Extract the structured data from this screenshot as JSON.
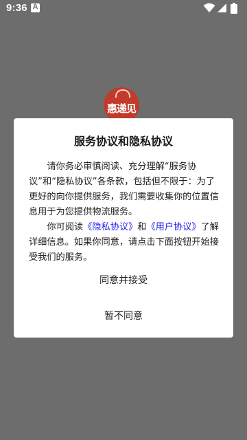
{
  "status_bar": {
    "time": "9:36",
    "notification_letter": "A",
    "icons": [
      "wifi-icon",
      "signal-icon",
      "battery-icon"
    ]
  },
  "app_logo": {
    "text": "惠递见"
  },
  "dialog": {
    "title": "服务协议和隐私协议",
    "paragraph1": "请你务必审慎阅读、充分理解“服务协议”和“隐私协议”各条款，包括但不限于：为了更好的向你提供服务，我们需要收集你的位置信息用于为您提供物流服务。",
    "paragraph2": {
      "prefix": "你可阅读",
      "privacy_link": "《隐私协议》",
      "middle": "和",
      "user_link": "《用户协议》",
      "suffix": "了解详细信息。如果你同意，请点击下面按钮开始接受我们的服务。"
    },
    "accept_label": "同意并接受",
    "decline_label": "暂不同意"
  },
  "colors": {
    "overlay": "#6d6d6d",
    "link": "#2222ee",
    "logo": "#c23a2b"
  }
}
